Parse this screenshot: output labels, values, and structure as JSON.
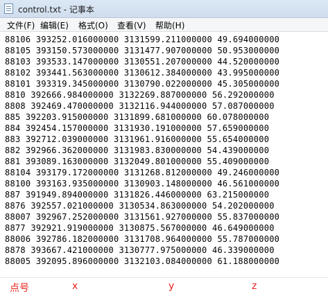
{
  "window": {
    "title": "control.txt - 记事本",
    "icon": "notepad-icon"
  },
  "menu": {
    "items": [
      {
        "label": "文件(F)"
      },
      {
        "label": "编辑(E)"
      },
      {
        "label": "格式(O)"
      },
      {
        "label": "查看(V)"
      },
      {
        "label": "帮助(H)"
      }
    ]
  },
  "content": {
    "lines": [
      "88106 393252.016000000 3131599.211000000 49.694000000",
      "88105 393150.573000000 3131477.907000000 50.953000000",
      "88103 393533.147000000 3130551.207000000 44.520000000",
      "88102 393441.563000000 3130612.384000000 43.995000000",
      "88101 393319.345000000 3130790.022000000 45.305000000",
      "8810 392666.984000000 3132269.887000000 56.292000000",
      "8808 392469.470000000 3132116.944000000 57.087000000",
      "885 392203.915000000 3131899.681000000 60.078000000",
      "884 392454.157000000 3131930.191000000 57.659000000",
      "883 392712.039000000 3131961.916000000 55.654000000",
      "882 392966.362000000 3131983.830000000 54.439000000",
      "881 393089.163000000 3132049.801000000 55.409000000",
      "88104 393179.172000000 3131268.812000000 49.246000000",
      "88100 393163.935000000 3130903.148000000 46.561000000",
      "887 391949.894000000 3131826.446000000 63.215000000",
      "8876 392557.021000000 3130534.863000000 54.202000000",
      "88007 392967.252000000 3131561.927000000 55.837000000",
      "8877 392921.919000000 3130875.567000000 46.649000000",
      "88006 392786.182000000 3131708.964000000 55.787000000",
      "8878 393667.421000000 3130777.975000000 46.339000000",
      "88005 392095.896000000 3132103.084000000 61.188000000"
    ]
  },
  "annotations": {
    "point_label": "点号",
    "x_label": "x",
    "y_label": "y",
    "z_label": "z",
    "color": "#e8251f"
  }
}
